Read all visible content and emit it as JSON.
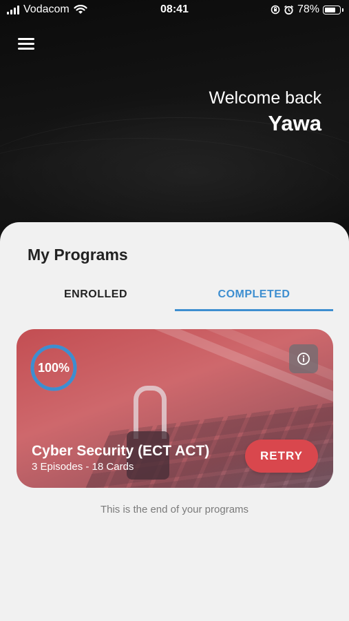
{
  "status_bar": {
    "carrier": "Vodacom",
    "time": "08:41",
    "battery": "78%",
    "battery_level": 0.78
  },
  "header": {
    "greeting": "Welcome back",
    "user_name": "Yawa"
  },
  "programs": {
    "title": "My Programs",
    "tabs": [
      {
        "label": "ENROLLED",
        "active": false
      },
      {
        "label": "COMPLETED",
        "active": true
      }
    ],
    "cards": [
      {
        "progress_label": "100%",
        "progress_value": 1.0,
        "title": "Cyber Security (ECT ACT)",
        "subtitle": "3 Episodes - 18 Cards",
        "action_label": "RETRY",
        "image_icon": "padlock-on-keyboard-image"
      }
    ],
    "end_note": "This is the end of your programs"
  },
  "colors": {
    "accent": "#3d8ed0",
    "retry_button": "#d9474d",
    "sheet_background": "#f1f1f1",
    "header_background": "#111111"
  },
  "icons": {
    "menu": "hamburger-menu-icon",
    "info": "info-icon",
    "wifi": "wifi-icon",
    "signal": "signal-icon",
    "alarm": "alarm-icon",
    "rotation_lock": "rotation-lock-icon"
  }
}
